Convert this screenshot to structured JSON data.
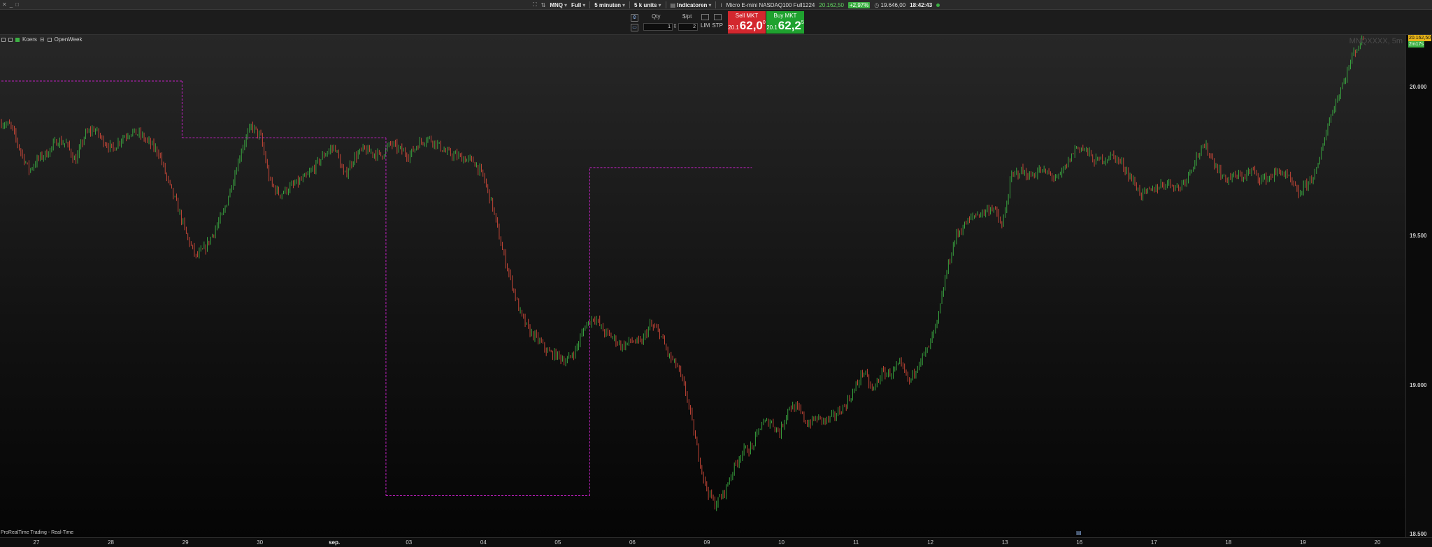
{
  "window": {
    "controls": [
      "✕",
      "_",
      "□"
    ]
  },
  "toolbar": {
    "symbol": "MNQ",
    "view": "Full",
    "timeframe": "5 minuten",
    "units": "5 k units",
    "indicators": "Indicatoren",
    "instrument": "Micro E-mini NASDAQ100 Full1224",
    "last_price": "20.162,50",
    "change_pct": "+2,97%",
    "prev_close": "19.646,00",
    "clock": "18:42:43"
  },
  "order": {
    "qty_label": "Qty",
    "pt_label": "$/pt",
    "qty_value": "1",
    "pt_value": "2",
    "lim_label": "LIM",
    "stp_label": "STP",
    "sell_label": "Sell MKT",
    "sell_prefix": "20.1",
    "sell_big": "62,0",
    "sell_sup": "0",
    "buy_label": "Buy MKT",
    "buy_prefix": "20.1",
    "buy_big": "62,2",
    "buy_sup": "5"
  },
  "chart": {
    "legend": {
      "price": "Koers",
      "indicator": "OpenWeek"
    },
    "watermark": "MNQXXXX, 5m",
    "footer": "ProRealTime Trading - Real-Time",
    "price_tag": "20.162,50",
    "timer_tag": "2m17s",
    "colors": {
      "up": "#3cb043",
      "down": "#d44a3a",
      "openweek": "#c020c0",
      "tag": "#e8b419"
    }
  },
  "chart_data": {
    "type": "candlestick",
    "timeframe": "5 minuten",
    "y_ticks": [
      "20.000",
      "19.500",
      "19.000",
      "18.500"
    ],
    "ylim": [
      18500,
      20170
    ],
    "x_ticks": [
      "27",
      "28",
      "29",
      "30",
      "sep.",
      "03",
      "04",
      "05",
      "06",
      "09",
      "10",
      "11",
      "12",
      "13",
      "16",
      "17",
      "18",
      "19",
      "20"
    ],
    "price_path": [
      [
        0,
        19880
      ],
      [
        2,
        19870
      ],
      [
        4,
        19790
      ],
      [
        6,
        19720
      ],
      [
        8,
        19760
      ],
      [
        10,
        19780
      ],
      [
        12,
        19820
      ],
      [
        14,
        19810
      ],
      [
        16,
        19750
      ],
      [
        18,
        19840
      ],
      [
        20,
        19860
      ],
      [
        22,
        19820
      ],
      [
        24,
        19790
      ],
      [
        26,
        19830
      ],
      [
        28,
        19850
      ],
      [
        30,
        19840
      ],
      [
        32,
        19810
      ],
      [
        34,
        19780
      ],
      [
        36,
        19680
      ],
      [
        38,
        19600
      ],
      [
        40,
        19500
      ],
      [
        42,
        19430
      ],
      [
        44,
        19460
      ],
      [
        46,
        19520
      ],
      [
        48,
        19580
      ],
      [
        50,
        19690
      ],
      [
        52,
        19800
      ],
      [
        54,
        19870
      ],
      [
        56,
        19830
      ],
      [
        58,
        19680
      ],
      [
        60,
        19640
      ],
      [
        62,
        19660
      ],
      [
        64,
        19680
      ],
      [
        66,
        19700
      ],
      [
        68,
        19740
      ],
      [
        70,
        19780
      ],
      [
        72,
        19800
      ],
      [
        74,
        19700
      ],
      [
        76,
        19760
      ],
      [
        78,
        19790
      ],
      [
        80,
        19780
      ],
      [
        82,
        19770
      ],
      [
        84,
        19810
      ],
      [
        86,
        19790
      ],
      [
        88,
        19770
      ],
      [
        90,
        19810
      ],
      [
        92,
        19830
      ],
      [
        94,
        19810
      ],
      [
        96,
        19780
      ],
      [
        98,
        19770
      ],
      [
        100,
        19760
      ],
      [
        102,
        19750
      ],
      [
        104,
        19700
      ],
      [
        106,
        19600
      ],
      [
        108,
        19460
      ],
      [
        110,
        19350
      ],
      [
        112,
        19240
      ],
      [
        114,
        19180
      ],
      [
        116,
        19150
      ],
      [
        118,
        19110
      ],
      [
        120,
        19100
      ],
      [
        122,
        19080
      ],
      [
        124,
        19120
      ],
      [
        126,
        19200
      ],
      [
        128,
        19230
      ],
      [
        130,
        19180
      ],
      [
        132,
        19160
      ],
      [
        134,
        19130
      ],
      [
        136,
        19150
      ],
      [
        138,
        19140
      ],
      [
        140,
        19200
      ],
      [
        142,
        19180
      ],
      [
        144,
        19100
      ],
      [
        146,
        19060
      ],
      [
        148,
        18960
      ],
      [
        150,
        18800
      ],
      [
        152,
        18660
      ],
      [
        154,
        18600
      ],
      [
        156,
        18640
      ],
      [
        158,
        18720
      ],
      [
        160,
        18780
      ],
      [
        162,
        18790
      ],
      [
        164,
        18870
      ],
      [
        166,
        18880
      ],
      [
        168,
        18840
      ],
      [
        170,
        18930
      ],
      [
        172,
        18920
      ],
      [
        174,
        18870
      ],
      [
        176,
        18890
      ],
      [
        178,
        18880
      ],
      [
        180,
        18900
      ],
      [
        182,
        18930
      ],
      [
        184,
        18980
      ],
      [
        186,
        19050
      ],
      [
        188,
        18980
      ],
      [
        190,
        19040
      ],
      [
        192,
        19040
      ],
      [
        194,
        19070
      ],
      [
        196,
        19010
      ],
      [
        198,
        19080
      ],
      [
        200,
        19120
      ],
      [
        202,
        19210
      ],
      [
        204,
        19380
      ],
      [
        206,
        19500
      ],
      [
        208,
        19540
      ],
      [
        210,
        19570
      ],
      [
        212,
        19580
      ],
      [
        214,
        19600
      ],
      [
        216,
        19530
      ],
      [
        218,
        19700
      ],
      [
        220,
        19720
      ],
      [
        222,
        19700
      ],
      [
        224,
        19720
      ],
      [
        226,
        19710
      ],
      [
        228,
        19690
      ],
      [
        230,
        19740
      ],
      [
        232,
        19800
      ],
      [
        234,
        19790
      ],
      [
        236,
        19750
      ],
      [
        238,
        19760
      ],
      [
        240,
        19770
      ],
      [
        242,
        19740
      ],
      [
        244,
        19690
      ],
      [
        246,
        19640
      ],
      [
        248,
        19650
      ],
      [
        250,
        19670
      ],
      [
        252,
        19680
      ],
      [
        254,
        19660
      ],
      [
        256,
        19700
      ],
      [
        258,
        19770
      ],
      [
        260,
        19800
      ],
      [
        262,
        19740
      ],
      [
        264,
        19690
      ],
      [
        266,
        19700
      ],
      [
        268,
        19700
      ],
      [
        270,
        19720
      ],
      [
        272,
        19690
      ],
      [
        274,
        19700
      ],
      [
        276,
        19720
      ],
      [
        278,
        19690
      ],
      [
        280,
        19640
      ],
      [
        282,
        19680
      ],
      [
        284,
        19720
      ],
      [
        286,
        19860
      ],
      [
        288,
        19950
      ],
      [
        290,
        20030
      ],
      [
        292,
        20120
      ],
      [
        294,
        20162
      ]
    ],
    "openweek_levels": [
      {
        "from": 0,
        "to": 39,
        "price": 20020
      },
      {
        "from": 39,
        "to": 83,
        "price": 19830
      },
      {
        "from": 83,
        "to": 127,
        "price": 18630
      },
      {
        "from": 127,
        "to": 162,
        "price": 19730
      }
    ]
  }
}
